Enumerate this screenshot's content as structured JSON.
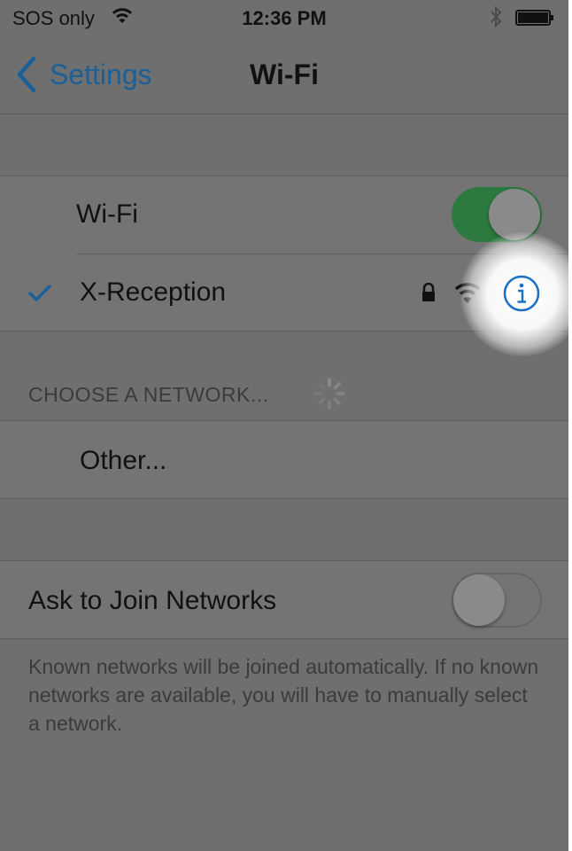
{
  "status_bar": {
    "carrier": "SOS only",
    "time": "12:36 PM",
    "icons": [
      "wifi-icon",
      "bluetooth-icon",
      "battery-icon"
    ]
  },
  "nav": {
    "back_label": "Settings",
    "title": "Wi-Fi"
  },
  "wifi_group": {
    "wifi_label": "Wi-Fi",
    "wifi_toggle_on": true,
    "connected_network": "X-Reception",
    "connected_icons": [
      "checkmark-icon",
      "lock-icon",
      "wifi-signal-icon",
      "info-icon"
    ]
  },
  "choose_section": {
    "header": "CHOOSE A NETWORK...",
    "other_label": "Other..."
  },
  "ask_group": {
    "label": "Ask to Join Networks",
    "toggle_on": false,
    "footer": "Known networks will be joined automatically. If no known networks are available, you will have to manually select a network."
  },
  "colors": {
    "accent": "#1b5f99",
    "toggle_on": "#2c7a3f",
    "dim_background": "#6f6f6f"
  }
}
